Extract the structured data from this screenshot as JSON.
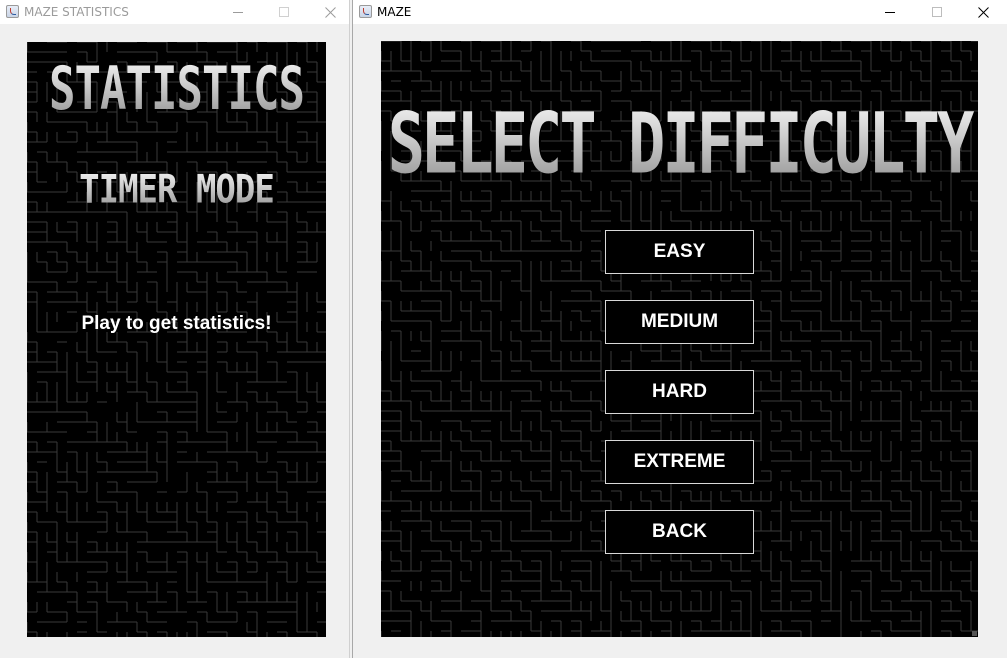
{
  "stats_window": {
    "title": "MAZE STATISTICS",
    "heading": "STATISTICS",
    "mode": "TIMER MODE",
    "message": "Play to get statistics!"
  },
  "maze_window": {
    "title": "MAZE",
    "heading": "SELECT DIFFICULTY",
    "buttons": [
      "EASY",
      "MEDIUM",
      "HARD",
      "EXTREME",
      "BACK"
    ]
  },
  "window_controls": {
    "minimize_icon": "minimize-icon",
    "maximize_icon": "maximize-icon",
    "close_icon": "close-icon"
  },
  "colors": {
    "panel_background": "#000000",
    "maze_lines": "#3a3a3a",
    "button_border": "#d8d8d8",
    "text": "#ffffff"
  }
}
